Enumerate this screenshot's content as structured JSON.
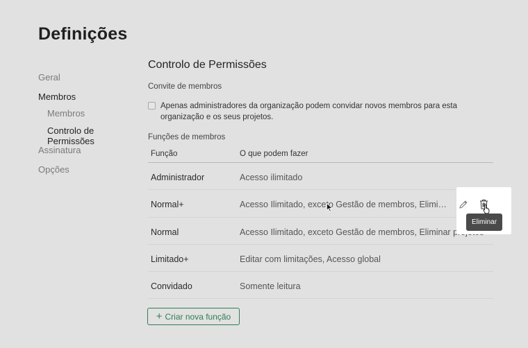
{
  "page": {
    "title": "Definições"
  },
  "sidebar": {
    "items": [
      {
        "label": "Geral"
      },
      {
        "label": "Membros"
      },
      {
        "label": "Assinatura"
      },
      {
        "label": "Opções"
      }
    ],
    "sub_items": [
      {
        "label": "Membros"
      },
      {
        "label": "Controlo de Permissões"
      }
    ]
  },
  "main": {
    "title": "Controlo de Permissões",
    "invite": {
      "label": "Convite de membros",
      "checkbox_checked": false,
      "checkbox_text": "Apenas administradores da organização podem convidar novos membros para esta organização e os seus projetos."
    },
    "roles": {
      "label": "Funções de membros",
      "columns": [
        "Função",
        "O que podem fazer"
      ],
      "rows": [
        {
          "role": "Administrador",
          "permissions": "Acesso ilimitado"
        },
        {
          "role": "Normal+",
          "permissions": "Acesso Ilimitado, exceto Gestão de membros, Eliminar projetos"
        },
        {
          "role": "Normal",
          "permissions": "Acesso Ilimitado, exceto Gestão de membros, Eliminar projetos"
        },
        {
          "role": "Limitado+",
          "permissions": "Editar com limitações, Acesso global"
        },
        {
          "role": "Convidado",
          "permissions": "Somente leitura"
        }
      ]
    },
    "actions": {
      "tooltip": "Eliminar",
      "edit_icon": "pencil-icon",
      "delete_icon": "trash-icon"
    },
    "create_button": {
      "icon": "+",
      "label": "Criar nova função"
    }
  },
  "colors": {
    "background": "#e1e1e1",
    "accent": "#2f7d55",
    "tooltip_bg": "#4a4a4a"
  }
}
